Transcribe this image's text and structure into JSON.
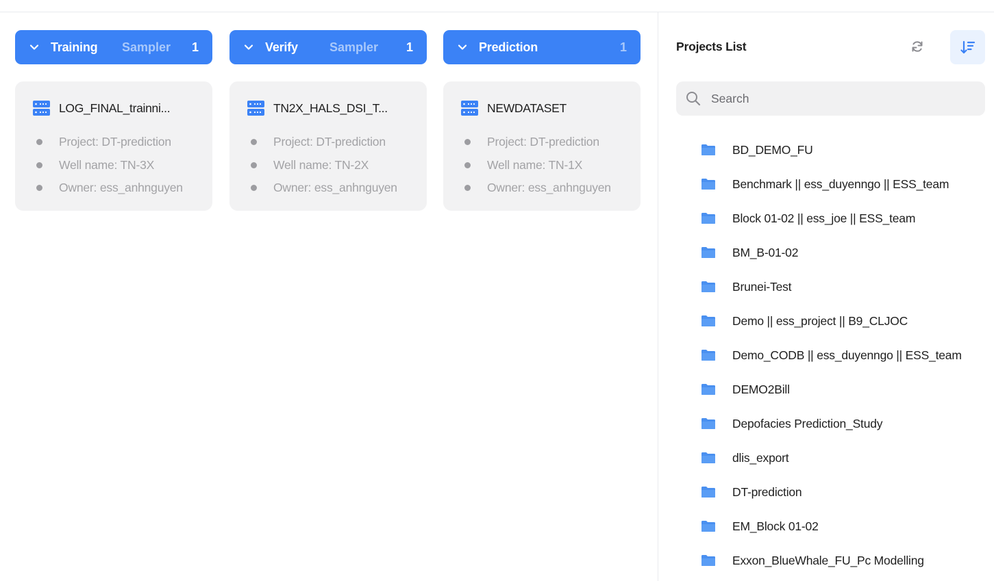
{
  "columns": [
    {
      "title": "Training",
      "subtitle": "Sampler",
      "count": "1",
      "card": {
        "name": "LOG_FINAL_trainni...",
        "project": "Project: DT-prediction",
        "well": "Well name: TN-3X",
        "owner": "Owner: ess_anhnguyen"
      }
    },
    {
      "title": "Verify",
      "subtitle": "Sampler",
      "count": "1",
      "card": {
        "name": "TN2X_HALS_DSI_T...",
        "project": "Project: DT-prediction",
        "well": "Well name: TN-2X",
        "owner": "Owner: ess_anhnguyen"
      }
    },
    {
      "title": "Prediction",
      "subtitle": "",
      "count": "1",
      "card": {
        "name": "NEWDATASET",
        "project": "Project: DT-prediction",
        "well": "Well name: TN-1X",
        "owner": "Owner: ess_anhnguyen"
      }
    }
  ],
  "panel": {
    "title": "Projects List",
    "refresh_icon": "refresh-icon",
    "sort_icon": "sort-icon",
    "search_placeholder": "Search",
    "projects": [
      "BD_DEMO_FU",
      "Benchmark || ess_duyenngo || ESS_team",
      "Block 01-02 || ess_joe || ESS_team",
      "BM_B-01-02",
      "Brunei-Test",
      "Demo || ess_project || B9_CLJOC",
      "Demo_CODB || ess_duyenngo || ESS_team",
      "DEMO2Bill",
      "Depofacies Prediction_Study",
      "dlis_export",
      "DT-prediction",
      "EM_Block 01-02",
      "Exxon_BlueWhale_FU_Pc Modelling"
    ]
  },
  "colors": {
    "accent": "#3b82f6",
    "header_sub": "#a8c8fb",
    "card_bg": "#f2f2f3",
    "muted_text": "#a3a3a6",
    "folder": "#4a90f0"
  }
}
